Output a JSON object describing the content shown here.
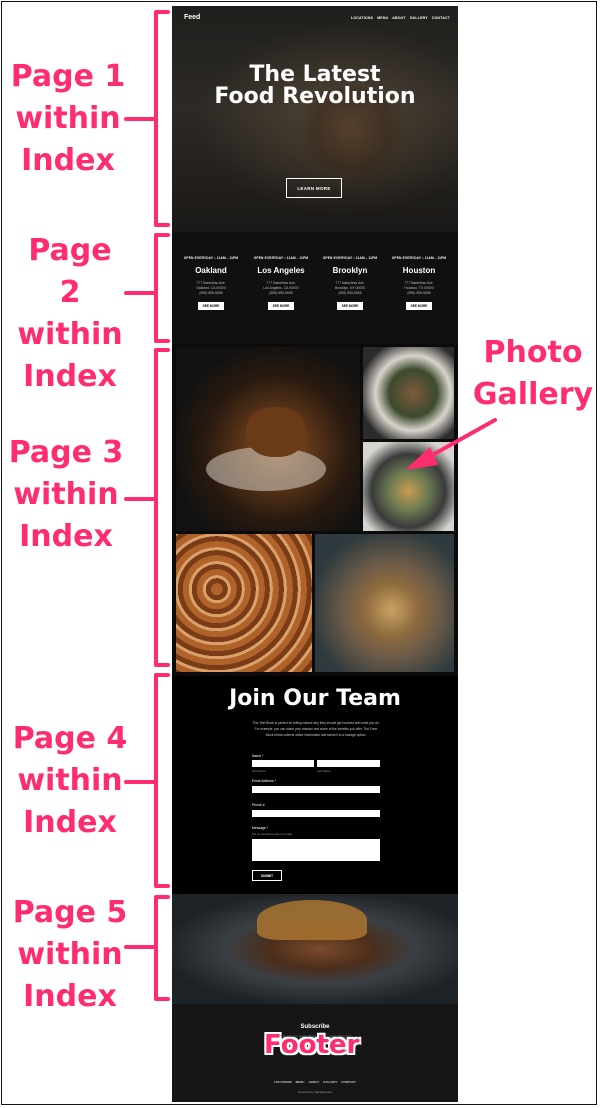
{
  "site": {
    "logo": "Feed",
    "nav": [
      "LOCATIONS",
      "MENU",
      "ABOUT",
      "GALLERY",
      "CONTACT"
    ],
    "hero": {
      "title_line1": "The Latest",
      "title_line2": "Food Revolution",
      "button": "LEARN MORE"
    },
    "locations": [
      {
        "hours": "OPEN EVERYDAY • 11AM - 11PM",
        "city": "Oakland",
        "address": "777 Nameless Ave.",
        "region": "Oakland, CA 00000",
        "phone": "(555) 555-5555",
        "button": "SEE MORE"
      },
      {
        "hours": "OPEN EVERYDAY • 11AM - 11PM",
        "city": "Los Angeles",
        "address": "777 Nameless Ave.",
        "region": "Los Angeles, CA 00000",
        "phone": "(555) 555-5555",
        "button": "SEE MORE"
      },
      {
        "hours": "OPEN EVERYDAY • 11AM - 11PM",
        "city": "Brooklyn",
        "address": "777 Nameless Ave.",
        "region": "Brooklyn, NY 00000",
        "phone": "(555) 555-5555",
        "button": "SEE MORE"
      },
      {
        "hours": "OPEN EVERYDAY • 11AM - 11PM",
        "city": "Houston",
        "address": "777 Nameless Ave.",
        "region": "Houston, TX 00000",
        "phone": "(555) 555-5555",
        "button": "SEE MORE"
      }
    ],
    "join": {
      "title": "Join Our Team",
      "intro": "This Text Block is perfect for telling visitors why they should get involved with what you do. For example, you can share your mission and some of the benefits you offer. The Form Block below collects visitor information and sends it to a storage option.",
      "name_label": "Name *",
      "first_name": "First Name",
      "last_name": "Last Name",
      "email_label": "Email Address *",
      "phone_label": "Phone #",
      "message_label": "Message *",
      "message_hint": "Tell us something about yourself",
      "submit": "SUBMIT"
    },
    "footer": {
      "subscribe": "Subscribe",
      "subscribe_text": "Sign up with your email address to receive news and updates.",
      "nav": [
        "LOCATIONS",
        "MENU",
        "ABOUT",
        "GALLERY",
        "CONTACT"
      ],
      "powered": "Powered by Squarespace"
    }
  },
  "annotations": {
    "page1": [
      "Page 1",
      "within",
      "Index"
    ],
    "page2": [
      "Page 2",
      "within",
      "Index"
    ],
    "page3": [
      "Page 3",
      "within",
      "Index"
    ],
    "page4": [
      "Page 4",
      "within",
      "Index"
    ],
    "page5": [
      "Page 5",
      "within",
      "Index"
    ],
    "gallery": [
      "Photo",
      "Gallery"
    ],
    "footer": "Footer"
  },
  "colors": {
    "annotation": "#ff2d6f",
    "site_background": "#0b0b0b"
  }
}
